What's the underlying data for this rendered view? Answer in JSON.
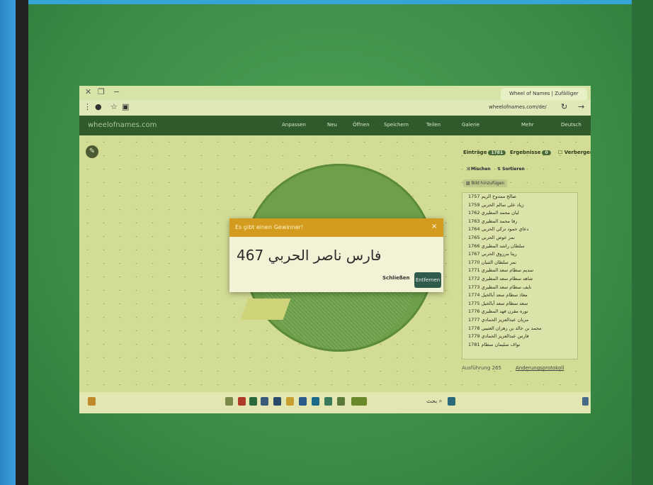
{
  "browser": {
    "tab_title": "Wheel of Names | Zufälliger",
    "url": "wheelofnames.com/de/"
  },
  "app": {
    "site_name": "wheelofnames.com",
    "nav": [
      "Anpassen",
      "Neu",
      "Öffnen",
      "Speichern",
      "Teilen",
      "Galerie",
      "Mehr",
      "Deutsch"
    ]
  },
  "sidebar": {
    "tab_entries": "Einträge",
    "tab_entries_count": "1781",
    "tab_results": "Ergebnisse",
    "tab_results_count": "0",
    "hide_label": "Verbergen",
    "shuffle_label": "Mischen",
    "sort_label": "Sortieren",
    "add_image_label": "Bild hinzufügen",
    "entries": [
      "صالح ممدوح الريم 1757",
      "زياد علي سالم الحربي 1759",
      "ليان محمد المطيري 1762",
      "رفا محمد المطيري 1763",
      "دعاي حمود تركي الحربي 1764",
      "نمر عوض الحربي 1765",
      "سلطان راشد المطيري 1766",
      "ريتا مرزوق الحربي 1767",
      "نمر سلطان الثنيان 1770",
      "سديم سطام سعد المطيري 1771",
      "شاهد سطام سعد المطيري 1772",
      "نايف سطام سعد المطيري 1773",
      "معاذ سطام سعد أبالخيل 1774",
      "سعد سطام سعد أبالخيل 1775",
      "نوره مقرن فهد المطيري 1776",
      "مزيان عبدالعزيز الحمادي 1777",
      "محمد بن خالد بن زهران العتيبي 1778",
      "فارس عبدالعزيز الحمادي 1779",
      "نواف سليمان سطام 1781"
    ],
    "footer_count": "Ausführung 265",
    "footer_link": "Anderungsprotokoll"
  },
  "dialog": {
    "title": "Es gibt einen Gewinner!",
    "winner": "فارس ناصر الحربي 467",
    "close_label": "Schließen",
    "remove_label": "Entfernen"
  },
  "taskbar": {
    "search_label": "بحث"
  }
}
